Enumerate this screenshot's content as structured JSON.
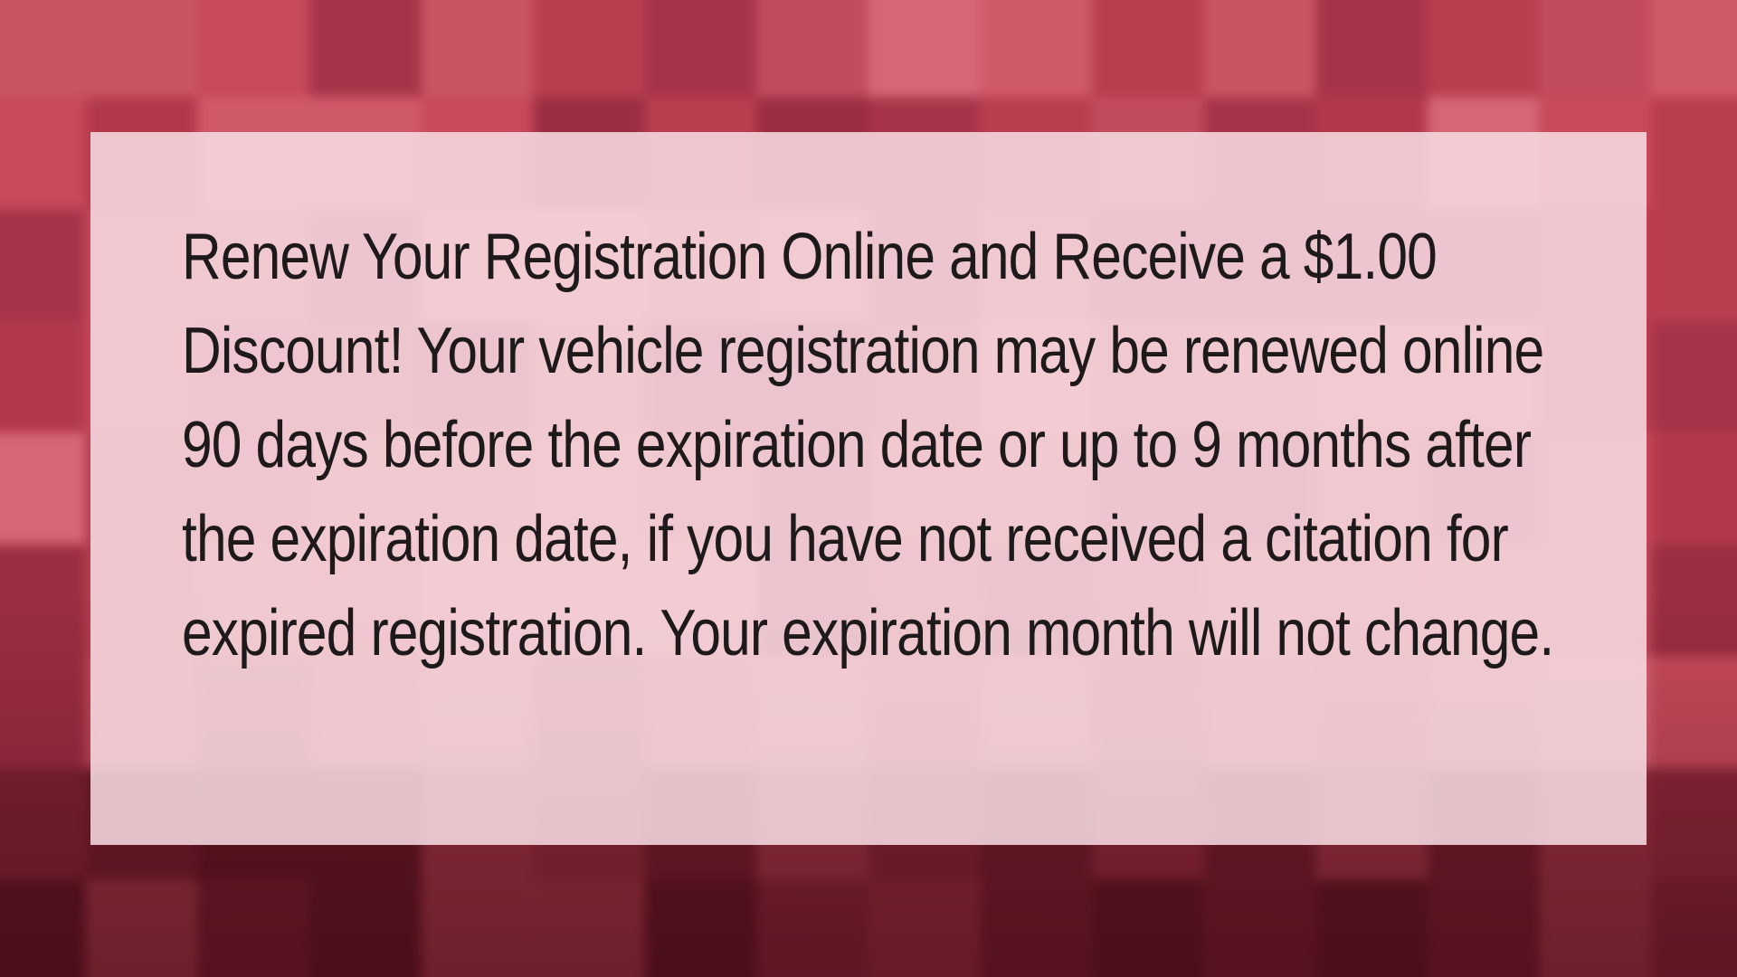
{
  "notice": {
    "message": "Renew Your Registration Online and Receive a $1.00 Discount! Your vehicle registration may be renewed online 90 days before the expiration date or up to 9 months after the expiration date, if you have not received a citation for expired registration. Your expiration month will not change."
  },
  "colors": {
    "background": "#b9404f",
    "card": "#f6dae0",
    "text": "#1e1a1b"
  }
}
